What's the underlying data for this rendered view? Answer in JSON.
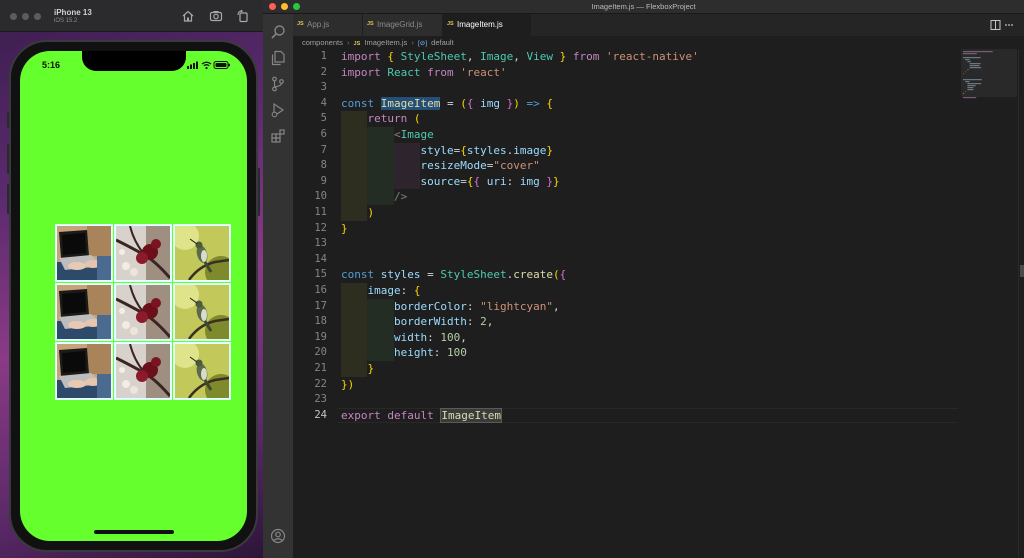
{
  "simulator": {
    "device_name": "iPhone 13",
    "os_version": "iOS 15.2",
    "status_time": "5:16",
    "screen_bg": "#64ff2c",
    "grid": {
      "border_color": "lightcyan",
      "rows": [
        [
          "laptop-typing-photo",
          "cherry-blossom-photo",
          "hummingbird-photo"
        ],
        [
          "laptop-typing-photo",
          "cherry-blossom-photo",
          "hummingbird-photo"
        ],
        [
          "laptop-typing-photo",
          "cherry-blossom-photo",
          "hummingbird-photo"
        ]
      ]
    }
  },
  "editor": {
    "window_title": "ImageItem.js — FlexboxProject",
    "tabs": [
      {
        "label": "App.js",
        "active": false
      },
      {
        "label": "ImageGrid.js",
        "active": false
      },
      {
        "label": "ImageItem.js",
        "active": true
      }
    ],
    "breadcrumb": {
      "folder": "components",
      "file": "ImageItem.js",
      "symbol": "default"
    },
    "current_line": 24,
    "code_lines": [
      "import { StyleSheet, Image, View } from 'react-native'",
      "import React from 'react'",
      "",
      "const ImageItem = ({ img }) => {",
      "    return (",
      "        <Image",
      "            style={styles.image}",
      "            resizeMode=\"cover\"",
      "            source={{ uri: img }}",
      "        />",
      "    )",
      "}",
      "",
      "",
      "const styles = StyleSheet.create({",
      "    image: {",
      "        borderColor: \"lightcyan\",",
      "        borderWidth: 2,",
      "        width: 100,",
      "        height: 100",
      "    }",
      "})",
      "",
      "export default ImageItem"
    ],
    "colors": {
      "keyword": "#c586c0",
      "string": "#ce9178",
      "class": "#4ec9b0",
      "number": "#b5cea8"
    }
  }
}
